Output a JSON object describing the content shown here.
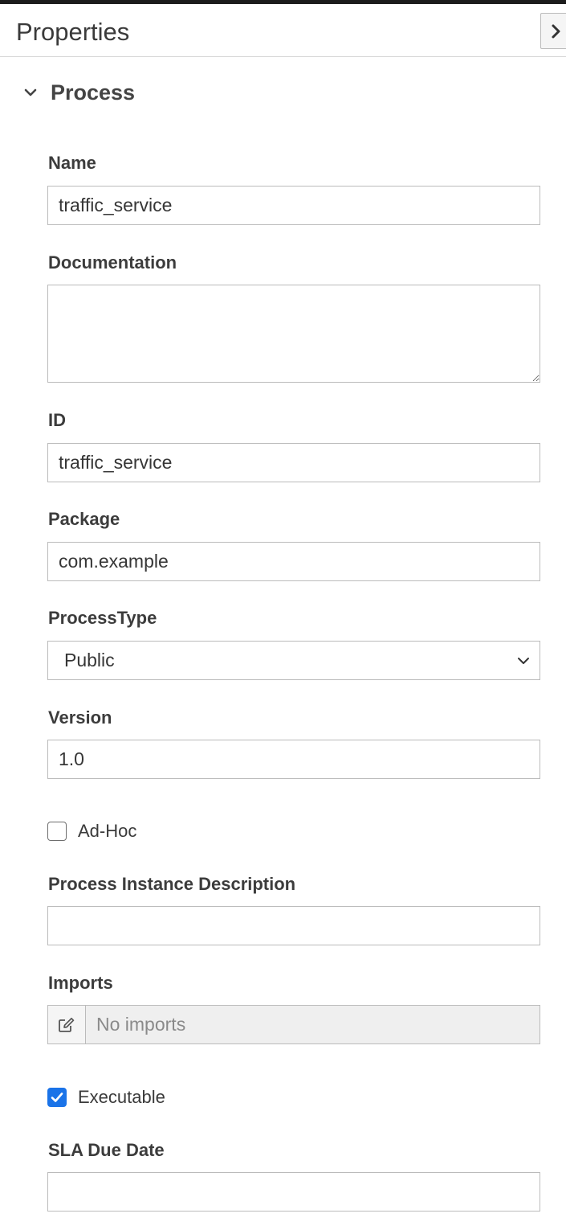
{
  "header": {
    "title": "Properties"
  },
  "section": {
    "title": "Process"
  },
  "fields": {
    "name": {
      "label": "Name",
      "value": "traffic_service"
    },
    "documentation": {
      "label": "Documentation",
      "value": ""
    },
    "id": {
      "label": "ID",
      "value": "traffic_service"
    },
    "package": {
      "label": "Package",
      "value": "com.example"
    },
    "process_type": {
      "label": "ProcessType",
      "value": "Public"
    },
    "version": {
      "label": "Version",
      "value": "1.0"
    },
    "adhoc": {
      "label": "Ad-Hoc",
      "checked": false
    },
    "instance_description": {
      "label": "Process Instance Description",
      "value": ""
    },
    "imports": {
      "label": "Imports",
      "value": "No imports"
    },
    "executable": {
      "label": "Executable",
      "checked": true
    },
    "sla_due_date": {
      "label": "SLA Due Date",
      "value": ""
    }
  },
  "icons": {
    "collapse": "chevron-right-icon",
    "section_toggle": "chevron-down-icon",
    "select": "chevron-down-icon",
    "imports_edit": "edit-icon",
    "checkmark": "check-icon"
  },
  "colors": {
    "accent": "#1a73e8",
    "border": "#bbbbbb",
    "topbar": "#1c1c1c",
    "readonly_bg": "#efefef"
  }
}
